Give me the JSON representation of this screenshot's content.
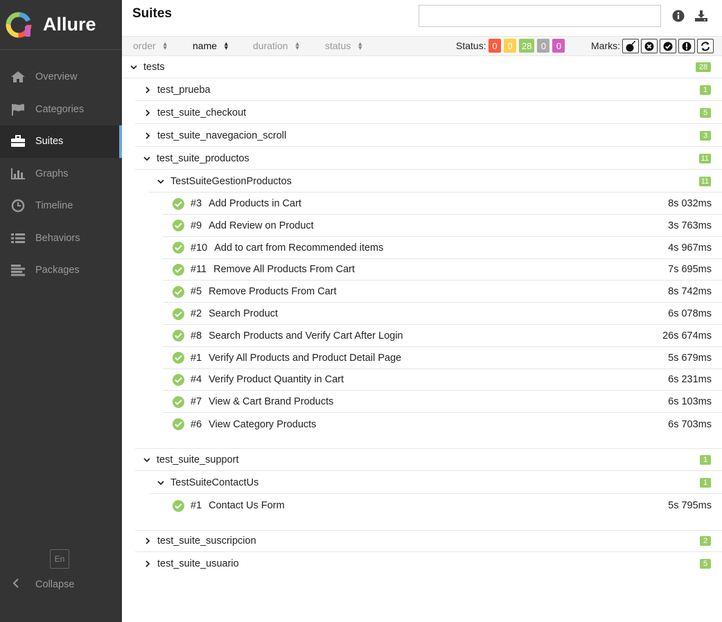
{
  "app": {
    "brand": "Allure"
  },
  "colors": {
    "sidebar_bg": "#343434",
    "passed": "#97cc64",
    "failed": "#fd5a3e",
    "broken": "#ffd050",
    "skipped": "#aaaaaa",
    "unknown": "#d35ebe",
    "active_bar": "#6aa6d8"
  },
  "nav": {
    "items": [
      {
        "label": "Overview",
        "icon": "home-icon"
      },
      {
        "label": "Categories",
        "icon": "flag-icon"
      },
      {
        "label": "Suites",
        "icon": "briefcase-icon",
        "active": true
      },
      {
        "label": "Graphs",
        "icon": "bar-chart-icon"
      },
      {
        "label": "Timeline",
        "icon": "clock-icon"
      },
      {
        "label": "Behaviors",
        "icon": "list-icon"
      },
      {
        "label": "Packages",
        "icon": "align-left-icon"
      }
    ],
    "lang": "En",
    "collapse": "Collapse"
  },
  "header": {
    "title": "Suites",
    "search_value": "",
    "search_placeholder": ""
  },
  "toolbar": {
    "sort": [
      "order",
      "name",
      "duration",
      "status"
    ],
    "active_sort": "name",
    "status_label": "Status:",
    "status_counts": {
      "failed": "0",
      "broken": "0",
      "passed": "28",
      "skipped": "0",
      "unknown": "0"
    },
    "marks_label": "Marks:",
    "marks": [
      "flaky-bomb-icon",
      "new-failed-icon",
      "new-passed-icon",
      "new-broken-icon",
      "retries-icon"
    ]
  },
  "tree": {
    "root": {
      "name": "tests",
      "count": "28"
    },
    "suites": [
      {
        "name": "test_prueba",
        "count": "1"
      },
      {
        "name": "test_suite_checkout",
        "count": "5"
      },
      {
        "name": "test_suite_navegacion_scroll",
        "count": "3"
      },
      {
        "name": "test_suite_productos",
        "count": "11",
        "subsuite": {
          "name": "TestSuiteGestionProductos",
          "count": "11"
        },
        "tests": [
          {
            "num": "#3",
            "name": "Add Products in Cart",
            "duration": "8s 032ms"
          },
          {
            "num": "#9",
            "name": "Add Review on Product",
            "duration": "3s 763ms"
          },
          {
            "num": "#10",
            "name": "Add to cart from Recommended items",
            "duration": "4s 967ms"
          },
          {
            "num": "#11",
            "name": "Remove All Products From Cart",
            "duration": "7s 695ms"
          },
          {
            "num": "#5",
            "name": "Remove Products From Cart",
            "duration": "8s 742ms"
          },
          {
            "num": "#2",
            "name": "Search Product",
            "duration": "6s 078ms"
          },
          {
            "num": "#8",
            "name": "Search Products and Verify Cart After Login",
            "duration": "26s 674ms"
          },
          {
            "num": "#1",
            "name": "Verify All Products and Product Detail Page",
            "duration": "5s 679ms"
          },
          {
            "num": "#4",
            "name": "Verify Product Quantity in Cart",
            "duration": "6s 231ms"
          },
          {
            "num": "#7",
            "name": "View & Cart Brand Products",
            "duration": "6s 103ms"
          },
          {
            "num": "#6",
            "name": "View Category Products",
            "duration": "6s 703ms"
          }
        ]
      },
      {
        "name": "test_suite_support",
        "count": "1",
        "subsuite": {
          "name": "TestSuiteContactUs",
          "count": "1"
        },
        "tests": [
          {
            "num": "#1",
            "name": "Contact Us Form",
            "duration": "5s 795ms"
          }
        ]
      },
      {
        "name": "test_suite_suscripcion",
        "count": "2"
      },
      {
        "name": "test_suite_usuario",
        "count": "5"
      }
    ]
  }
}
